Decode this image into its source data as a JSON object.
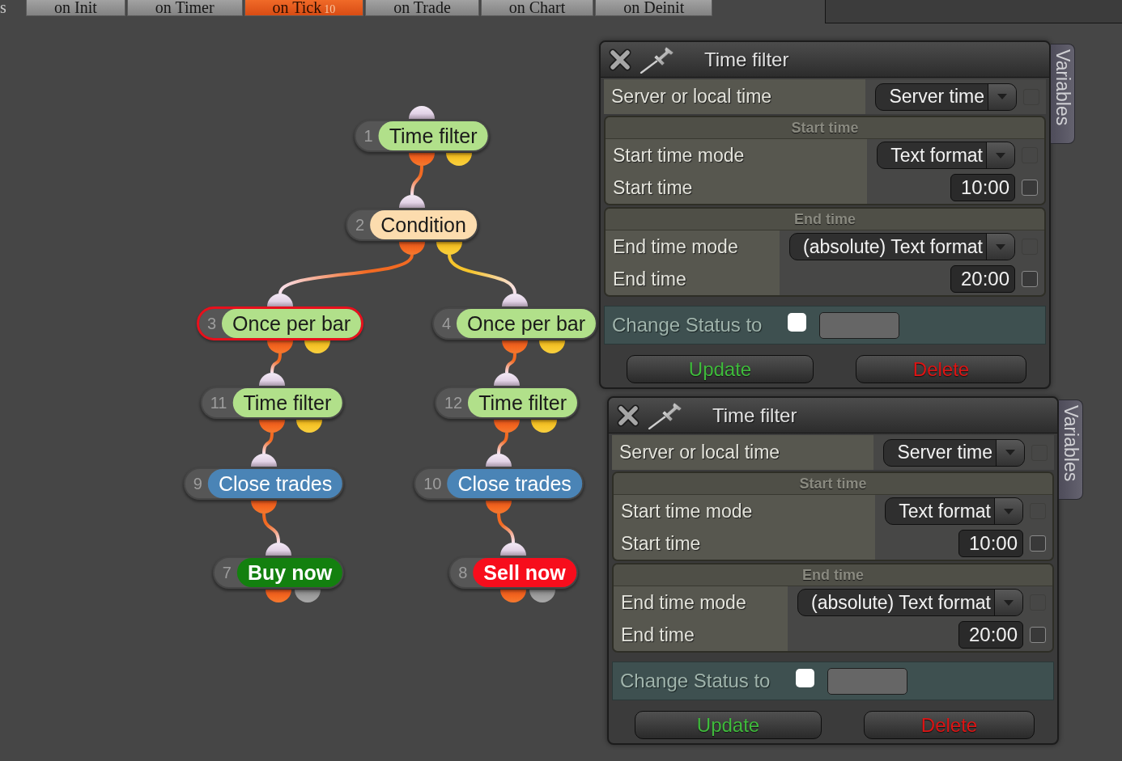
{
  "tab_bar": {
    "left_fragment": "s",
    "tabs": [
      {
        "label": "on Init",
        "selected": false
      },
      {
        "label": "on Timer",
        "selected": false
      },
      {
        "label": "on Tick",
        "badge": "10",
        "selected": true
      },
      {
        "label": "on Trade",
        "selected": false
      },
      {
        "label": "on Chart",
        "selected": false
      },
      {
        "label": "on Deinit",
        "selected": false
      }
    ]
  },
  "graph": {
    "nodes": [
      {
        "number": "1",
        "label": "Time filter",
        "kind": "filter",
        "color": "#b1e08a",
        "selected": false,
        "children": [
          {
            "alternate": false,
            "number": "2",
            "label": "Condition",
            "kind": "condition",
            "color": "#fcdcae",
            "selected": false,
            "children": [
              {
                "alternate": false,
                "number": "3",
                "label": "Once per bar",
                "kind": "filter",
                "color": "#b1e08a",
                "selected": true,
                "children": [
                  {
                    "alternate": false,
                    "number": "11",
                    "label": "Time filter",
                    "kind": "filter",
                    "color": "#b1e08a",
                    "selected": false,
                    "children": [
                      {
                        "alternate": false,
                        "number": "9",
                        "label": "Close trades",
                        "kind": "close",
                        "color": "#4a84b6",
                        "selected": false,
                        "children": [
                          {
                            "alternate": false,
                            "number": "7",
                            "label": "Buy now",
                            "kind": "order",
                            "color": "#13800f",
                            "selected": false
                          }
                        ]
                      }
                    ]
                  }
                ]
              },
              {
                "alternate": true,
                "number": "4",
                "label": "Once per bar",
                "kind": "filter",
                "color": "#b1e08a",
                "selected": false,
                "children": [
                  {
                    "alternate": false,
                    "number": "12",
                    "label": "Time filter",
                    "kind": "filter",
                    "color": "#b1e08a",
                    "selected": false,
                    "children": [
                      {
                        "alternate": false,
                        "number": "10",
                        "label": "Close trades",
                        "kind": "close",
                        "color": "#4a84b6",
                        "selected": false,
                        "children": [
                          {
                            "alternate": false,
                            "number": "8",
                            "label": "Sell now",
                            "kind": "order",
                            "color": "#f70d1c",
                            "selected": false
                          }
                        ]
                      }
                    ]
                  }
                ]
              }
            ]
          }
        ]
      }
    ]
  },
  "panels": [
    {
      "title": "Time filter",
      "side_tab": "Variables",
      "top_row": {
        "label": "Server or local time",
        "kind": "select",
        "value": "Server time",
        "checkbox": {
          "checked": false,
          "disabled": true
        }
      },
      "groups": [
        {
          "title": "Start time",
          "rows": [
            {
              "label": "Start time mode",
              "kind": "select",
              "value": "Text format",
              "checkbox": {
                "checked": false,
                "disabled": true
              }
            },
            {
              "label": "Start time",
              "kind": "input",
              "value": "10:00",
              "checkbox": {
                "checked": false,
                "disabled": false
              }
            }
          ]
        },
        {
          "title": "End time",
          "rows": [
            {
              "label": "End time mode",
              "kind": "select",
              "value": "(absolute) Text format",
              "checkbox": {
                "checked": false,
                "disabled": true
              }
            },
            {
              "label": "End time",
              "kind": "input",
              "value": "20:00",
              "checkbox": {
                "checked": false,
                "disabled": false
              }
            }
          ]
        }
      ],
      "status": {
        "label": "Change Status to",
        "checked": false
      },
      "buttons": [
        {
          "label": "Update",
          "kind": "update"
        },
        {
          "label": "Delete",
          "kind": "delete"
        }
      ]
    },
    {
      "title": "Time filter",
      "side_tab": "Variables",
      "top_row": {
        "label": "Server or local time",
        "kind": "select",
        "value": "Server time",
        "checkbox": {
          "checked": false,
          "disabled": true
        }
      },
      "groups": [
        {
          "title": "Start time",
          "rows": [
            {
              "label": "Start time mode",
              "kind": "select",
              "value": "Text format",
              "checkbox": {
                "checked": false,
                "disabled": true
              }
            },
            {
              "label": "Start time",
              "kind": "input",
              "value": "10:00",
              "checkbox": {
                "checked": false,
                "disabled": false
              }
            }
          ]
        },
        {
          "title": "End time",
          "rows": [
            {
              "label": "End time mode",
              "kind": "select",
              "value": "(absolute) Text format",
              "checkbox": {
                "checked": false,
                "disabled": true
              }
            },
            {
              "label": "End time",
              "kind": "input",
              "value": "20:00",
              "checkbox": {
                "checked": false,
                "disabled": false
              }
            }
          ]
        }
      ],
      "status": {
        "label": "Change Status to",
        "checked": false
      },
      "buttons": [
        {
          "label": "Update",
          "kind": "update"
        },
        {
          "label": "Delete",
          "kind": "delete"
        }
      ]
    }
  ]
}
